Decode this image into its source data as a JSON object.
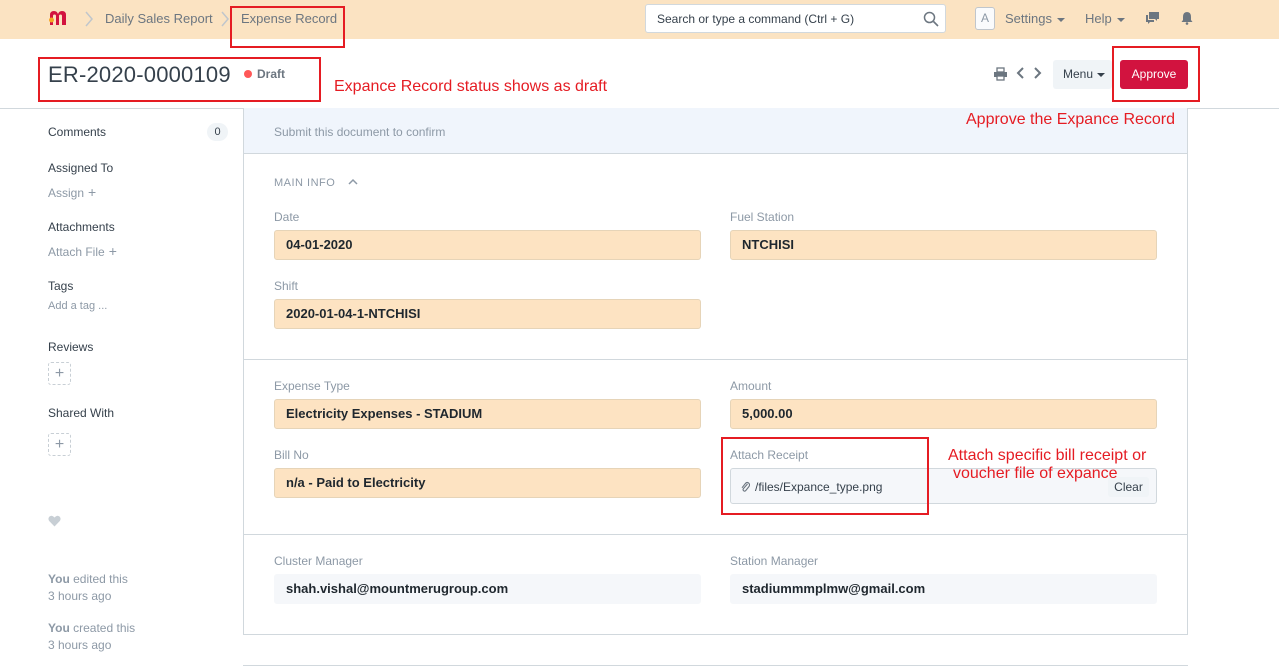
{
  "navbar": {
    "breadcrumbs": [
      "Daily Sales Report",
      "Expense Record"
    ],
    "search_placeholder": "Search or type a command (Ctrl + G)",
    "avatar_letter": "A",
    "settings_label": "Settings",
    "help_label": "Help"
  },
  "page": {
    "title": "ER-2020-0000109",
    "status": "Draft",
    "menu_label": "Menu",
    "approve_label": "Approve"
  },
  "sidebar": {
    "comments_label": "Comments",
    "comments_count": "0",
    "assigned_to_label": "Assigned To",
    "assign_label": "Assign",
    "attachments_label": "Attachments",
    "attach_file_label": "Attach File",
    "tags_label": "Tags",
    "add_tag_label": "Add a tag ...",
    "reviews_label": "Reviews",
    "shared_with_label": "Shared With",
    "activity": [
      {
        "actor": "You",
        "action": "edited this",
        "time": "3 hours ago"
      },
      {
        "actor": "You",
        "action": "created this",
        "time": "3 hours ago"
      }
    ]
  },
  "form": {
    "banner": "Submit this document to confirm",
    "section_title": "MAIN INFO",
    "date_label": "Date",
    "date_value": "04-01-2020",
    "fuel_station_label": "Fuel Station",
    "fuel_station_value": "NTCHISI",
    "shift_label": "Shift",
    "shift_value": "2020-01-04-1-NTCHISI",
    "expense_type_label": "Expense Type",
    "expense_type_value": "Electricity Expenses - STADIUM",
    "amount_label": "Amount",
    "amount_value": "5,000.00",
    "bill_no_label": "Bill No",
    "bill_no_value": "n/a - Paid to Electricity",
    "attach_receipt_label": "Attach Receipt",
    "attach_receipt_value": "/files/Expance_type.png",
    "clear_label": "Clear",
    "cluster_manager_label": "Cluster Manager",
    "cluster_manager_value": "shah.vishal@mountmerugroup.com",
    "station_manager_label": "Station Manager",
    "station_manager_value": "stadiummmplmw@gmail.com"
  },
  "annotations": {
    "status_note": "Expance Record status shows as draft",
    "approve_note": "Approve the Expance Record",
    "attach_note_line1": "Attach specific bill receipt or",
    "attach_note_line2": "voucher file of expance"
  },
  "colors": {
    "navbar_bg": "#fbe3c2",
    "approve_bg": "#d2133f",
    "field_bg": "#fde3c2",
    "annotation_red": "#e51c23",
    "status_dot": "#ff5858"
  }
}
